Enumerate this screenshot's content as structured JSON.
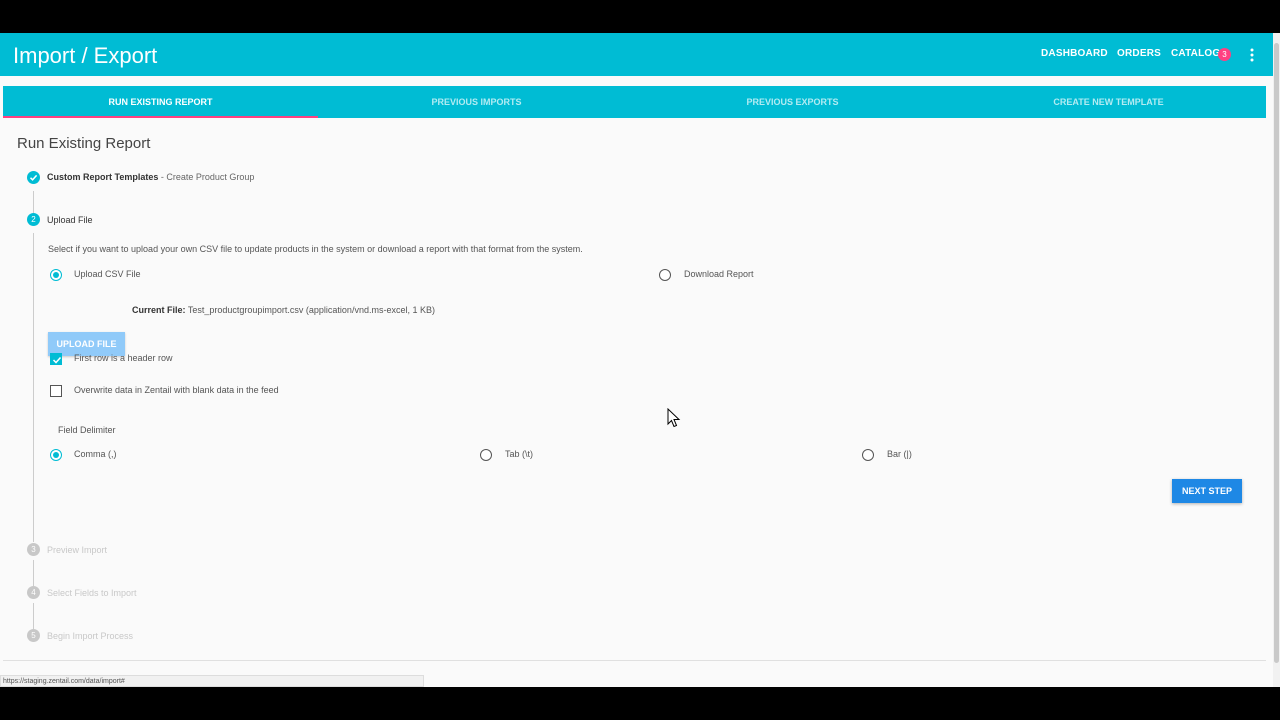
{
  "header": {
    "title": "Import / Export",
    "nav": [
      "DASHBOARD",
      "ORDERS",
      "CATALOG"
    ],
    "catalog_badge": "3"
  },
  "tabs": [
    {
      "label": "RUN EXISTING REPORT",
      "active": true
    },
    {
      "label": "PREVIOUS IMPORTS",
      "active": false
    },
    {
      "label": "PREVIOUS EXPORTS",
      "active": false
    },
    {
      "label": "CREATE NEW TEMPLATE",
      "active": false
    }
  ],
  "page": {
    "title": "Run Existing Report"
  },
  "steps": [
    {
      "number": "1",
      "label": "Custom Report Templates",
      "sub": " - Create Product Group",
      "status": "complete"
    },
    {
      "number": "2",
      "label": "Upload File",
      "status": "active"
    },
    {
      "number": "3",
      "label": "Preview Import",
      "status": "disabled"
    },
    {
      "number": "4",
      "label": "Select Fields to Import",
      "status": "disabled"
    },
    {
      "number": "5",
      "label": "Begin Import Process",
      "status": "disabled"
    }
  ],
  "upload": {
    "description": "Select if you want to upload your own CSV file to update products in the system or download a report with that format from the system.",
    "options": [
      {
        "label": "Upload CSV File",
        "selected": true
      },
      {
        "label": "Download Report",
        "selected": false
      }
    ],
    "button": "UPLOAD FILE",
    "current_file_label": "Current File:",
    "current_file_value": "Test_productgroupimport.csv (application/vnd.ms-excel, 1 KB)",
    "checkboxes": [
      {
        "label": "First row is a header row",
        "checked": true
      },
      {
        "label": "Overwrite data in Zentail with blank data in the feed",
        "checked": false
      }
    ],
    "delimiter_label": "Field Delimiter",
    "delimiters": [
      {
        "label": "Comma (,)",
        "selected": true
      },
      {
        "label": "Tab (\\t)",
        "selected": false
      },
      {
        "label": "Bar (|)",
        "selected": false
      }
    ],
    "next_button": "NEXT STEP"
  },
  "status_url": "https://staging.zentail.com/data/import#",
  "colors": {
    "primary": "#00bcd4",
    "accent": "#ff4081",
    "button": "#1e88e5"
  }
}
